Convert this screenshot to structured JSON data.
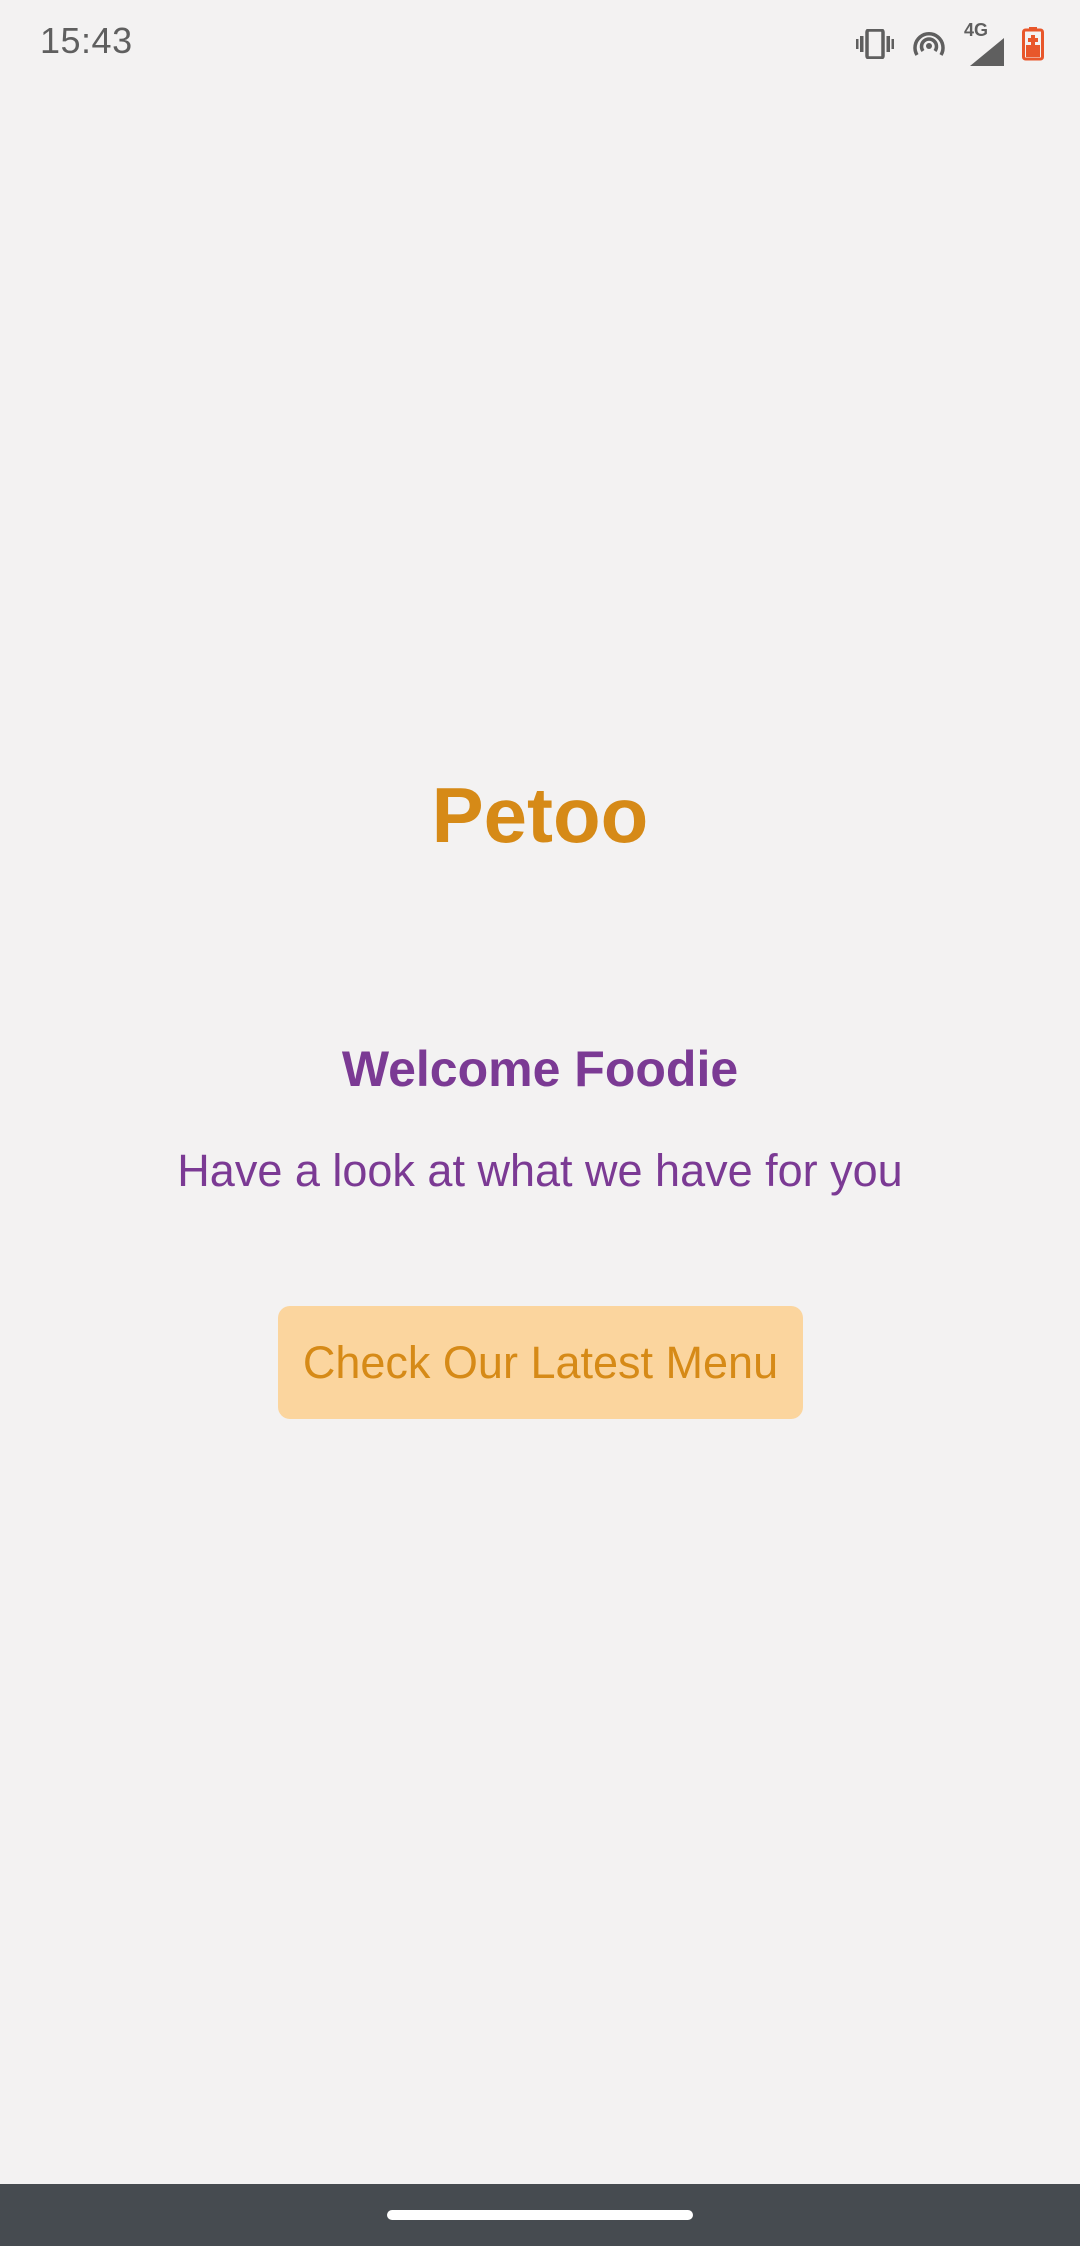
{
  "status_bar": {
    "time": "15:43",
    "network_label": "4G",
    "icons": [
      "vibrate-icon",
      "hotspot-icon",
      "signal-icon",
      "battery-charging-icon"
    ]
  },
  "main": {
    "app_title": "Petoo",
    "welcome_title": "Welcome Foodie",
    "welcome_subtitle": "Have a look at what we have for you",
    "menu_button_label": "Check Our Latest Menu"
  },
  "colors": {
    "background": "#f3f2f2",
    "accent_orange": "#d68a17",
    "accent_purple": "#7b3a94",
    "button_background": "#fbd59e",
    "nav_bar": "#464b50",
    "battery_red": "#e8572b"
  }
}
